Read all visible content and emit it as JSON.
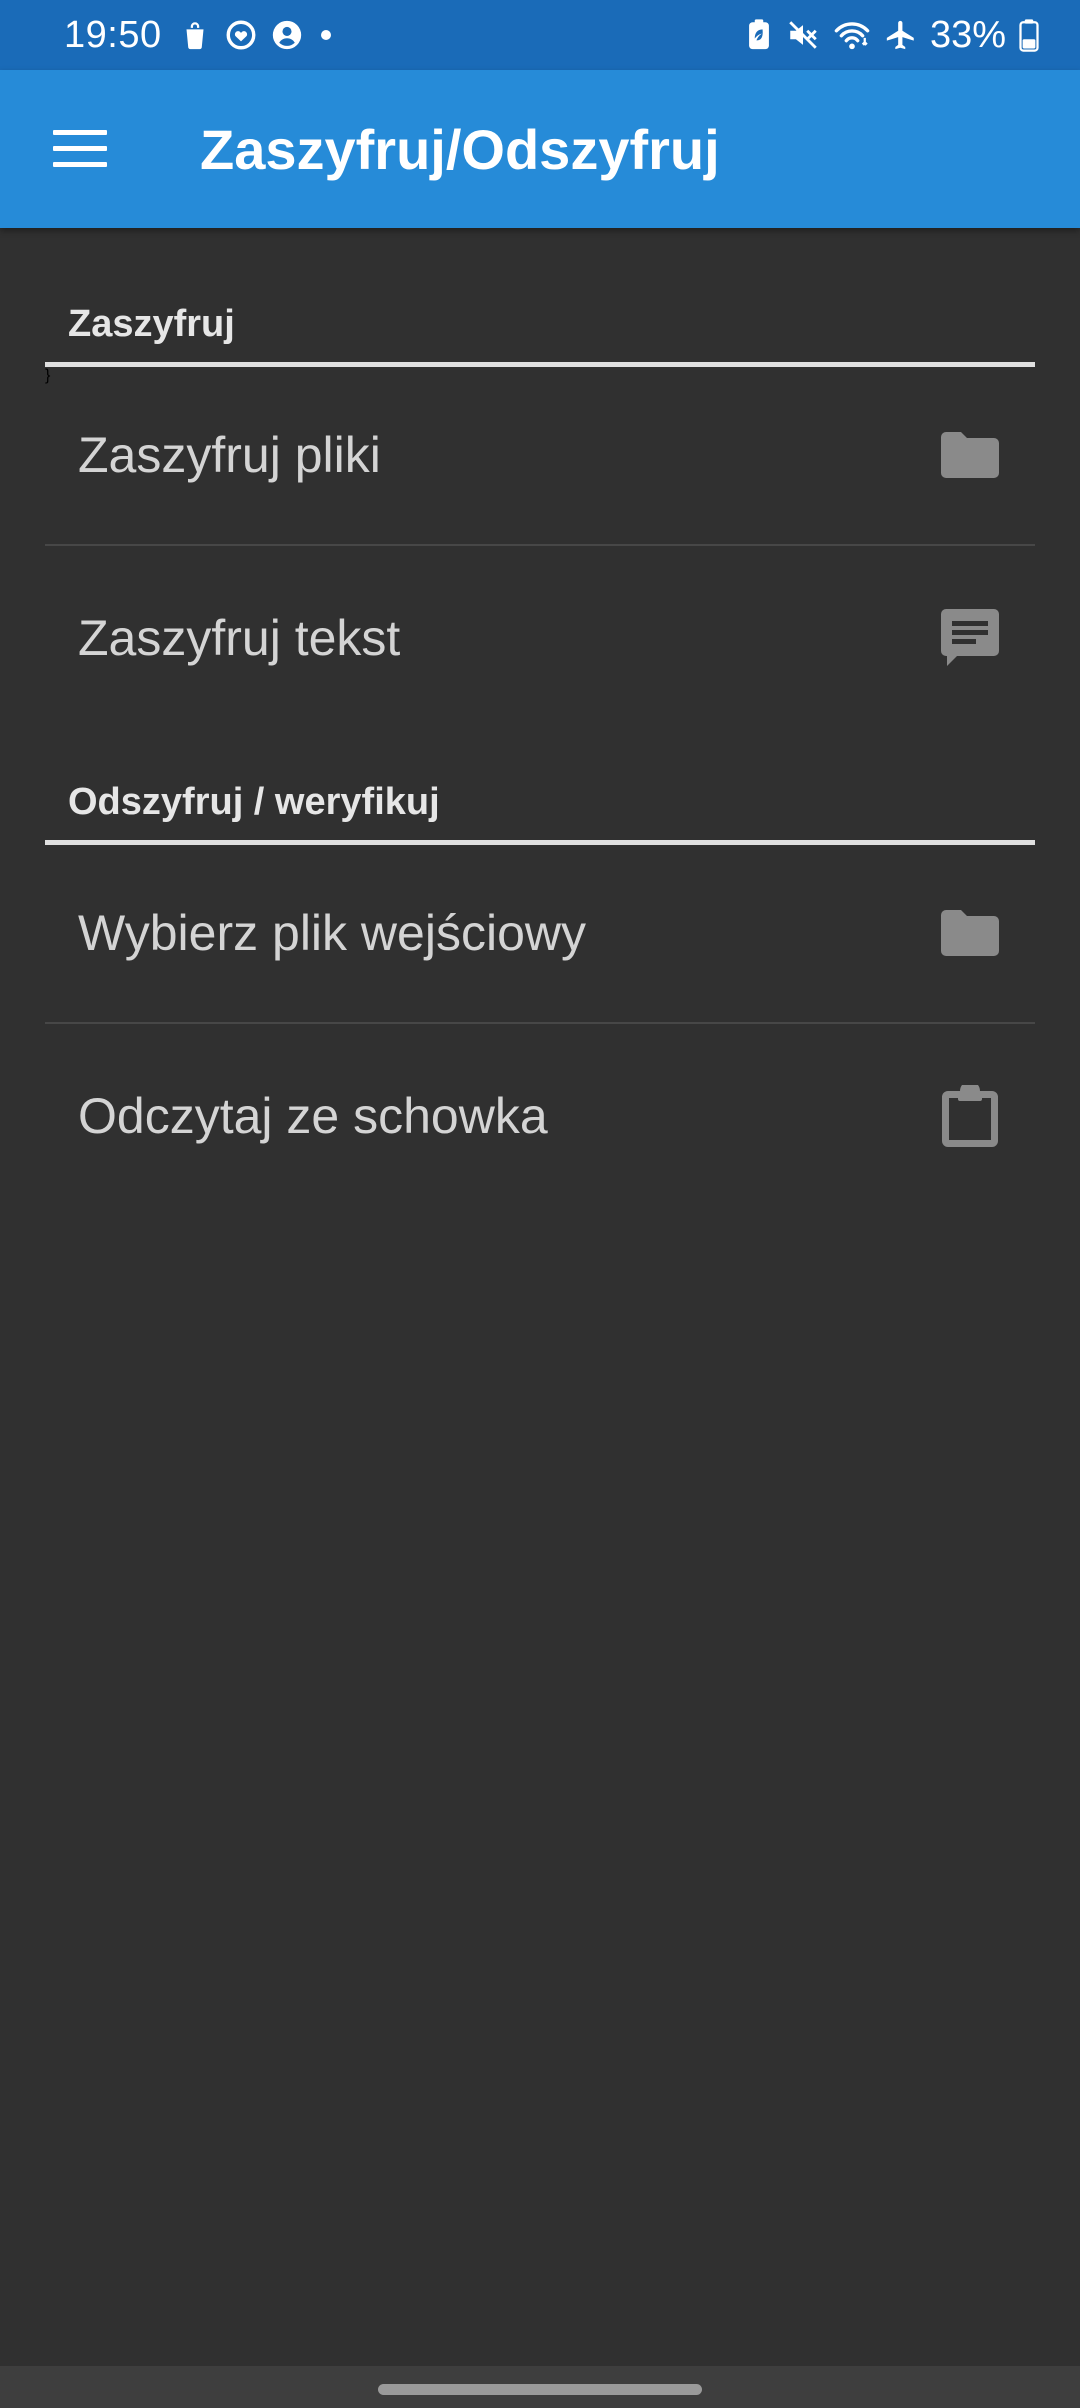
{
  "status_bar": {
    "time": "19:50",
    "battery_percent": "33%",
    "left_icons": [
      "shopping-bag-icon",
      "heart-circle-icon",
      "account-circle-icon",
      "dot-icon"
    ],
    "right_icons": [
      "battery-saver-icon",
      "mute-icon",
      "wifi-icon",
      "airplane-icon",
      "battery-icon"
    ]
  },
  "app_bar": {
    "title": "Zaszyfruj/Odszyfruj",
    "menu_icon": "menu-icon"
  },
  "sections": [
    {
      "title": "Zaszyfruj",
      "items": [
        {
          "label": "Zaszyfruj pliki",
          "icon": "folder-icon"
        },
        {
          "label": "Zaszyfruj tekst",
          "icon": "message-icon"
        }
      ]
    },
    {
      "title": "Odszyfruj / weryfikuj",
      "items": [
        {
          "label": "Wybierz plik wejściowy",
          "icon": "folder-icon"
        },
        {
          "label": "Odczytaj ze schowka",
          "icon": "clipboard-icon"
        }
      ]
    }
  ],
  "colors": {
    "status_bar": "#1a6bb8",
    "app_bar": "#268bd8",
    "background": "#303030",
    "icon": "#8a8a8a"
  }
}
